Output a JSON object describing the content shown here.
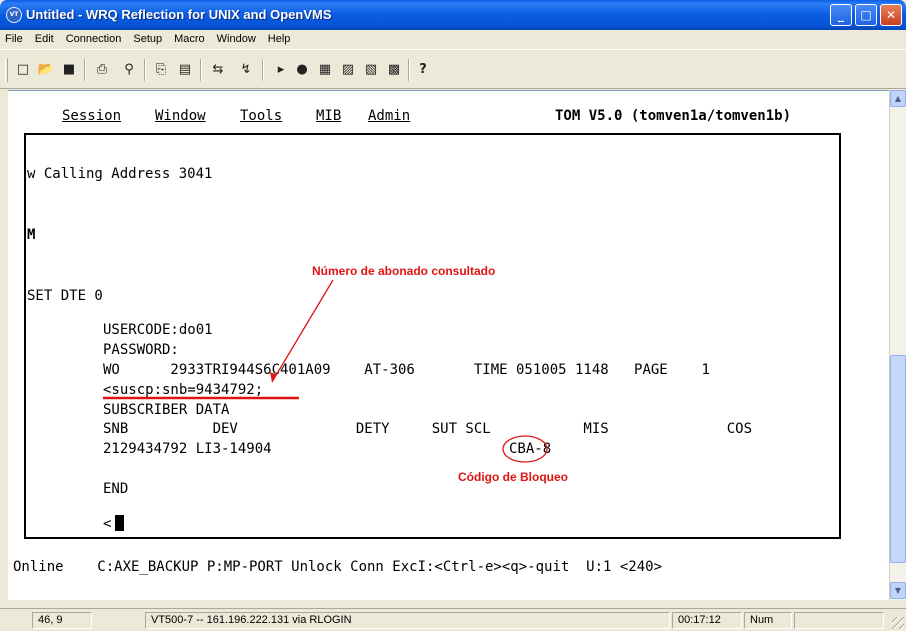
{
  "window": {
    "title": "Untitled - WRQ Reflection for UNIX and OpenVMS",
    "app_icon": "VT",
    "minimize": "_",
    "maximize": "□",
    "close": "✕"
  },
  "menubar": {
    "items": [
      "File",
      "Edit",
      "Connection",
      "Setup",
      "Macro",
      "Window",
      "Help"
    ]
  },
  "toolbar": {
    "icons": {
      "new": "□",
      "open": "📂",
      "save": "■",
      "print": "⎙",
      "find": "⚲",
      "copy": "⎘",
      "paste": "▤",
      "connect": "⇆",
      "disconnect": "↯",
      "play": "▸",
      "record": "●",
      "t1": "▦",
      "t2": "▨",
      "t3": "▧",
      "t4": "▩",
      "help": "?"
    }
  },
  "terminal": {
    "menu": {
      "session": "Session",
      "window": "Window",
      "tools": "Tools",
      "mib": "MIB",
      "admin": "Admin",
      "version": "TOM V5.0 (tomven1a/tomven1b)"
    },
    "lines": {
      "calling": "w Calling Address 3041",
      "m": "M",
      "set_dte": "SET DTE 0",
      "usercode": "USERCODE:do01",
      "password": "PASSWORD:",
      "wo_line": "WO      2933TRI944S6C401A09    AT-306       TIME 051005 1148   PAGE    1",
      "command": "<suscp:snb=9434792;",
      "subscriber_data": "SUBSCRIBER DATA",
      "headers": "SNB          DEV              DETY     SUT SCL           MIS              COS",
      "row": "2129434792 LI3-14904",
      "cba": "CBA-8",
      "end": "END",
      "prompt": "<"
    },
    "status_line": "Online    C:AXE_BACKUP P:MP-PORT Unlock Conn ExcI:<Ctrl-e><q>-quit  U:1 <240>"
  },
  "annotations": {
    "subscriber_label": "Número de abonado consultado",
    "block_label": "Código de Bloqueo"
  },
  "statusbar": {
    "cursor_pos": "46, 9",
    "connection": "VT500-7 -- 161.196.222.131 via RLOGIN",
    "clock": "00:17:12",
    "numlock": "Num"
  },
  "colors": {
    "annotation": "#e01313",
    "titlebar": "#0a5de3"
  }
}
